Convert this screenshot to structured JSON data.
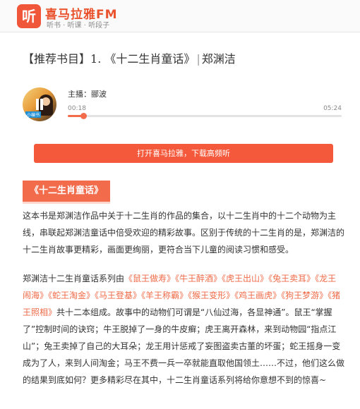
{
  "header": {
    "logo_glyph": "听",
    "brand": "喜马拉雅FM",
    "tagline": "听书 · 听课 · 听段子",
    "accent": "#f0573a"
  },
  "title": {
    "tag": "【推荐书目】",
    "book": "1. 《十二生肖童话》",
    "separator": "|",
    "author": "郑渊洁"
  },
  "player": {
    "cover_text": "语文",
    "cover_tagline": "小编书",
    "host": "主播：郦波",
    "current_time": "00:18",
    "total_time": "05:24",
    "progress": 0.056
  },
  "open_app_button": "打开喜马拉雅，下载高频听",
  "section_tag": "《十二生肖童话》",
  "intro": "这本书是郑渊洁作品中关于十二生肖的作品的集合，以十二生肖中的十二个动物为主线，串联起郑渊洁童话中倍受欢迎的精彩故事。区别于传统的十二生肖的是，郑渊洁的十二生肖故事更精彩，画面更绚丽，更符合当下儿童的阅读习惯和感受。",
  "series": {
    "prefix": "郑渊洁十二生肖童话系列由",
    "books": [
      "《鼠王做寿》",
      "《牛王醉酒》",
      "《虎王出山》",
      "《兔王卖耳》",
      "《龙王闹海》",
      "《蛇王淘金》",
      "《马王登基》",
      "《羊王称霸》",
      "《猴王变形》",
      "《鸡王画虎》",
      "《狗王梦游》",
      "《猪王照相》"
    ],
    "suffix": "共十二本组成。故事中的动物们可谓是“八仙过海，各显神通”。鼠王“掌握了”控制时间的诀窍；牛王脱掉了一身的牛皮癣；虎王离开森林，来到动物园“指点江山”；兔王卖掉了自己的大耳朵；龙王用计惩戒了妄图盗卖古董的坏蛋；蛇王摇身一变成为了人，来到人间淘金；马王不费一兵一卒就能直取他国领土……不过，他们这么做的结果到底如何？更多精彩尽在其中，十二生肖童话系列将给你意想不到的惊喜~"
  }
}
